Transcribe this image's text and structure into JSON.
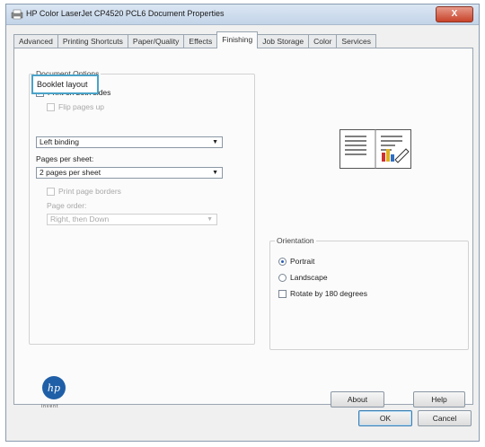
{
  "window": {
    "title": "HP Color LaserJet CP4520 PCL6 Document Properties",
    "close_glyph": "X"
  },
  "tabs": [
    {
      "label": "Advanced"
    },
    {
      "label": "Printing Shortcuts"
    },
    {
      "label": "Paper/Quality"
    },
    {
      "label": "Effects"
    },
    {
      "label": "Finishing"
    },
    {
      "label": "Job Storage"
    },
    {
      "label": "Color"
    },
    {
      "label": "Services"
    }
  ],
  "document_options": {
    "group_label": "Document Options",
    "print_both_sides": {
      "label": "Print on both sides",
      "checked": true
    },
    "flip_pages_up": {
      "label": "Flip pages up",
      "checked": false
    },
    "booklet_layout_label": "Booklet layout",
    "booklet_layout_value": "Left binding",
    "pages_per_sheet_label": "Pages per sheet:",
    "pages_per_sheet_value": "2 pages per sheet",
    "print_page_borders": {
      "label": "Print page borders",
      "checked": false
    },
    "page_order_label": "Page order:",
    "page_order_value": "Right, then Down"
  },
  "orientation": {
    "group_label": "Orientation",
    "portrait": {
      "label": "Portrait",
      "selected": true
    },
    "landscape": {
      "label": "Landscape",
      "selected": false
    },
    "rotate_180": {
      "label": "Rotate by 180 degrees",
      "checked": false
    }
  },
  "buttons": {
    "about": "About",
    "help": "Help",
    "ok": "OK",
    "cancel": "Cancel"
  },
  "branding": {
    "logo_text": "hp",
    "tagline": "invent"
  },
  "colors": {
    "accent": "#4aa3c9",
    "title_bar": "#c3d4e8",
    "close": "#c8432a"
  }
}
